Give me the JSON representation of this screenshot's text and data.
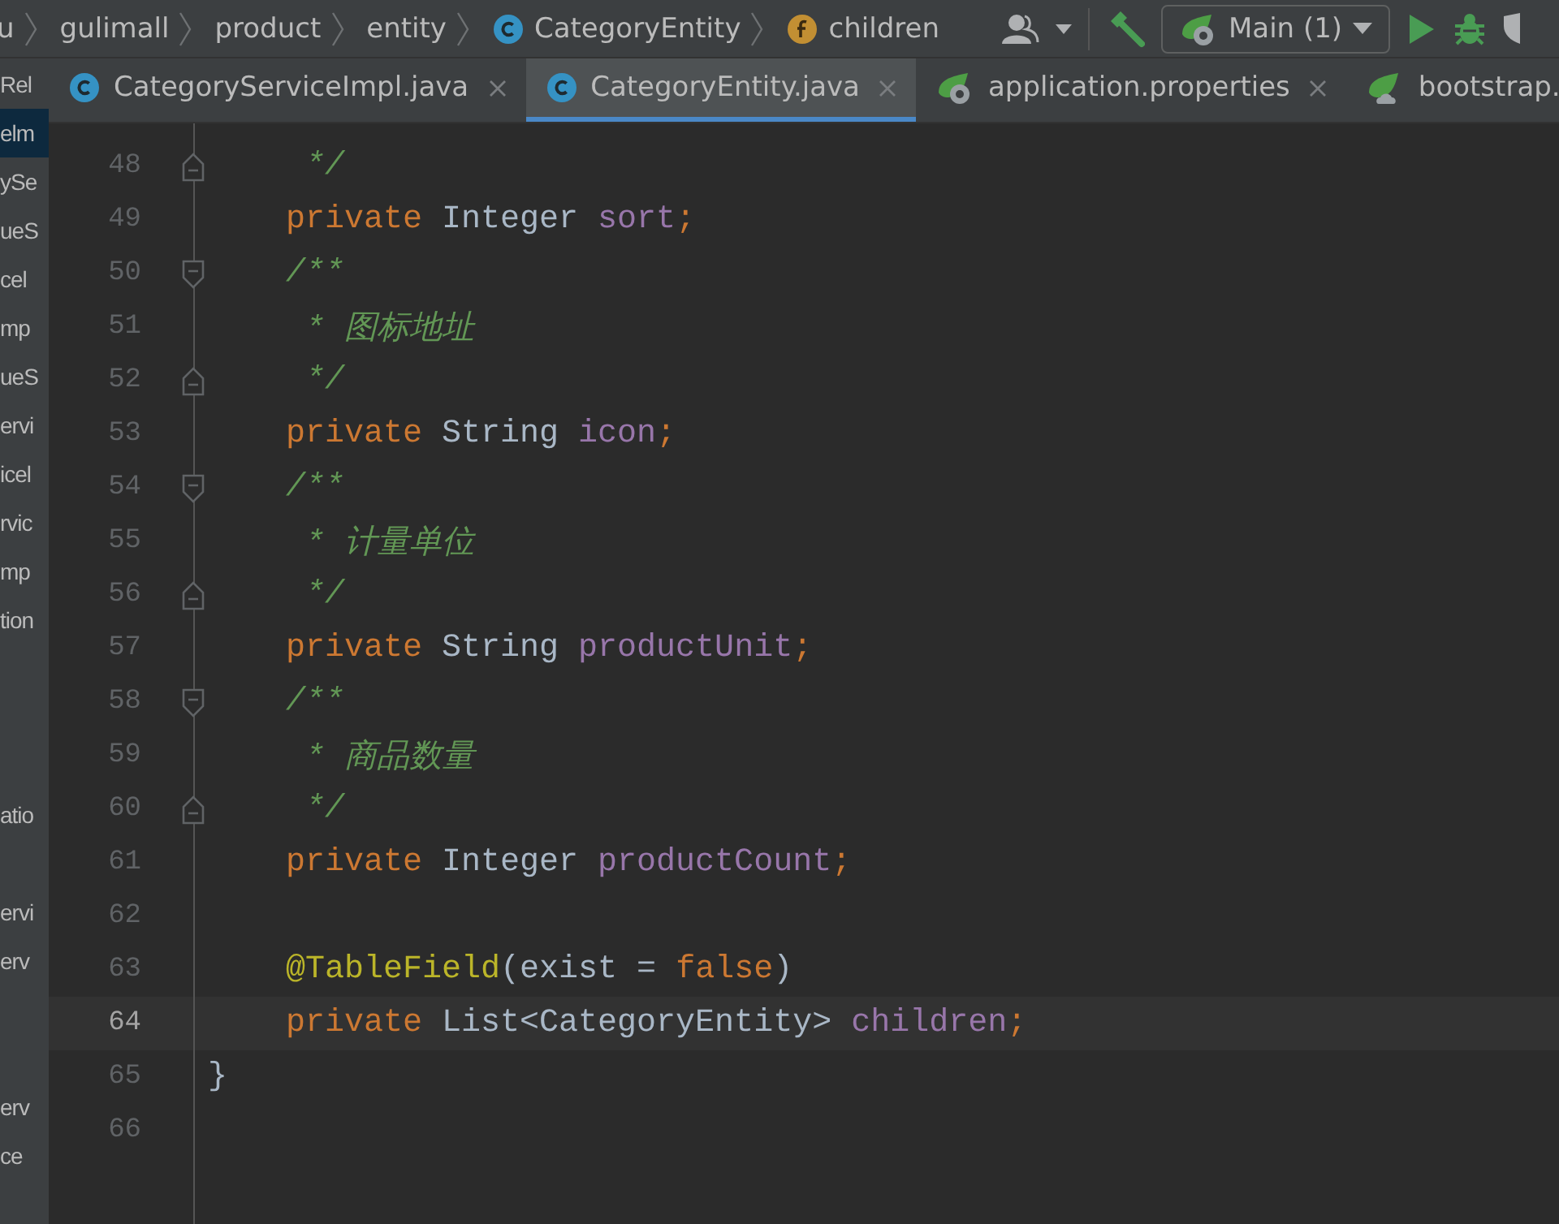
{
  "breadcrumbs": [
    {
      "label": "u",
      "kind": "folder"
    },
    {
      "label": "gulimall",
      "kind": "folder"
    },
    {
      "label": "product",
      "kind": "folder"
    },
    {
      "label": "entity",
      "kind": "folder"
    },
    {
      "label": "CategoryEntity",
      "kind": "class"
    },
    {
      "label": "children",
      "kind": "field"
    }
  ],
  "run_config": {
    "label": "Main (1)"
  },
  "sidebar": {
    "items": [
      {
        "label": "Rel",
        "selected": false
      },
      {
        "label": "elm",
        "selected": true
      },
      {
        "label": "ySe",
        "selected": false
      },
      {
        "label": "ueS",
        "selected": false
      },
      {
        "label": "cel",
        "selected": false
      },
      {
        "label": "mp",
        "selected": false
      },
      {
        "label": "ueS",
        "selected": false
      },
      {
        "label": "ervi",
        "selected": false
      },
      {
        "label": "icel",
        "selected": false
      },
      {
        "label": "rvic",
        "selected": false
      },
      {
        "label": "mp",
        "selected": false
      },
      {
        "label": "tion",
        "selected": false
      },
      {
        "selected": false
      },
      {
        "selected": false
      },
      {
        "selected": false
      },
      {
        "label": "atio",
        "selected": false
      },
      {
        "selected": false
      },
      {
        "label": "ervi",
        "selected": false
      },
      {
        "label": "erv",
        "selected": false
      },
      {
        "selected": false
      },
      {
        "selected": false
      },
      {
        "label": "erv",
        "selected": false
      },
      {
        "label": "ce",
        "selected": false
      }
    ]
  },
  "tabs": [
    {
      "label": "CategoryServiceImpl.java",
      "kind": "class",
      "selected": false,
      "closable": true
    },
    {
      "label": "CategoryEntity.java",
      "kind": "class",
      "selected": true,
      "closable": true
    },
    {
      "label": "application.properties",
      "kind": "properties",
      "selected": false,
      "closable": true
    },
    {
      "label": "bootstrap.",
      "kind": "config",
      "selected": false,
      "closable": false
    }
  ],
  "editor": {
    "lines": [
      {
        "number": "48",
        "kind": "closer",
        "current": false,
        "tokens": [
          {
            "kind": "comment",
            "text": "     */"
          }
        ]
      },
      {
        "number": "49",
        "kind": "plain",
        "current": false,
        "tokens": [
          {
            "kind": "keyword",
            "text": "    private "
          },
          {
            "kind": "plain",
            "text": "Integer "
          },
          {
            "kind": "field",
            "text": "sort"
          },
          {
            "kind": "keyword",
            "text": ";"
          }
        ]
      },
      {
        "number": "50",
        "kind": "opener",
        "current": false,
        "tokens": [
          {
            "kind": "comment",
            "text": "    /**"
          }
        ]
      },
      {
        "number": "51",
        "kind": "plain",
        "current": false,
        "tokens": [
          {
            "kind": "comment",
            "text": "     * 图标地址"
          }
        ]
      },
      {
        "number": "52",
        "kind": "closer",
        "current": false,
        "tokens": [
          {
            "kind": "comment",
            "text": "     */"
          }
        ]
      },
      {
        "number": "53",
        "kind": "plain",
        "current": false,
        "tokens": [
          {
            "kind": "keyword",
            "text": "    private "
          },
          {
            "kind": "plain",
            "text": "String "
          },
          {
            "kind": "field",
            "text": "icon"
          },
          {
            "kind": "keyword",
            "text": ";"
          }
        ]
      },
      {
        "number": "54",
        "kind": "opener",
        "current": false,
        "tokens": [
          {
            "kind": "comment",
            "text": "    /**"
          }
        ]
      },
      {
        "number": "55",
        "kind": "plain",
        "current": false,
        "tokens": [
          {
            "kind": "comment",
            "text": "     * 计量单位"
          }
        ]
      },
      {
        "number": "56",
        "kind": "closer",
        "current": false,
        "tokens": [
          {
            "kind": "comment",
            "text": "     */"
          }
        ]
      },
      {
        "number": "57",
        "kind": "plain",
        "current": false,
        "tokens": [
          {
            "kind": "keyword",
            "text": "    private "
          },
          {
            "kind": "plain",
            "text": "String "
          },
          {
            "kind": "field",
            "text": "productUnit"
          },
          {
            "kind": "keyword",
            "text": ";"
          }
        ]
      },
      {
        "number": "58",
        "kind": "opener",
        "current": false,
        "tokens": [
          {
            "kind": "comment",
            "text": "    /**"
          }
        ]
      },
      {
        "number": "59",
        "kind": "plain",
        "current": false,
        "tokens": [
          {
            "kind": "comment",
            "text": "     * 商品数量"
          }
        ]
      },
      {
        "number": "60",
        "kind": "closer",
        "current": false,
        "tokens": [
          {
            "kind": "comment",
            "text": "     */"
          }
        ]
      },
      {
        "number": "61",
        "kind": "plain",
        "current": false,
        "tokens": [
          {
            "kind": "keyword",
            "text": "    private "
          },
          {
            "kind": "plain",
            "text": "Integer "
          },
          {
            "kind": "field",
            "text": "productCount"
          },
          {
            "kind": "keyword",
            "text": ";"
          }
        ]
      },
      {
        "number": "62",
        "kind": "plain",
        "current": false
      },
      {
        "number": "63",
        "kind": "plain",
        "current": false,
        "tokens": [
          {
            "kind": "annotation",
            "text": "    @TableField"
          },
          {
            "kind": "plain",
            "text": "(exist = "
          },
          {
            "kind": "keyword",
            "text": "false"
          },
          {
            "kind": "plain",
            "text": ")"
          }
        ]
      },
      {
        "number": "64",
        "kind": "plain",
        "current": true,
        "tokens": [
          {
            "kind": "keyword",
            "text": "    private "
          },
          {
            "kind": "plain",
            "text": "List<CategoryEntity> "
          },
          {
            "kind": "field",
            "text": "children"
          },
          {
            "kind": "keyword",
            "text": ";"
          }
        ]
      },
      {
        "number": "65",
        "kind": "plain",
        "current": false,
        "tokens": [
          {
            "kind": "plain",
            "text": "}"
          }
        ]
      },
      {
        "number": "66",
        "kind": "plain",
        "current": false
      }
    ]
  }
}
